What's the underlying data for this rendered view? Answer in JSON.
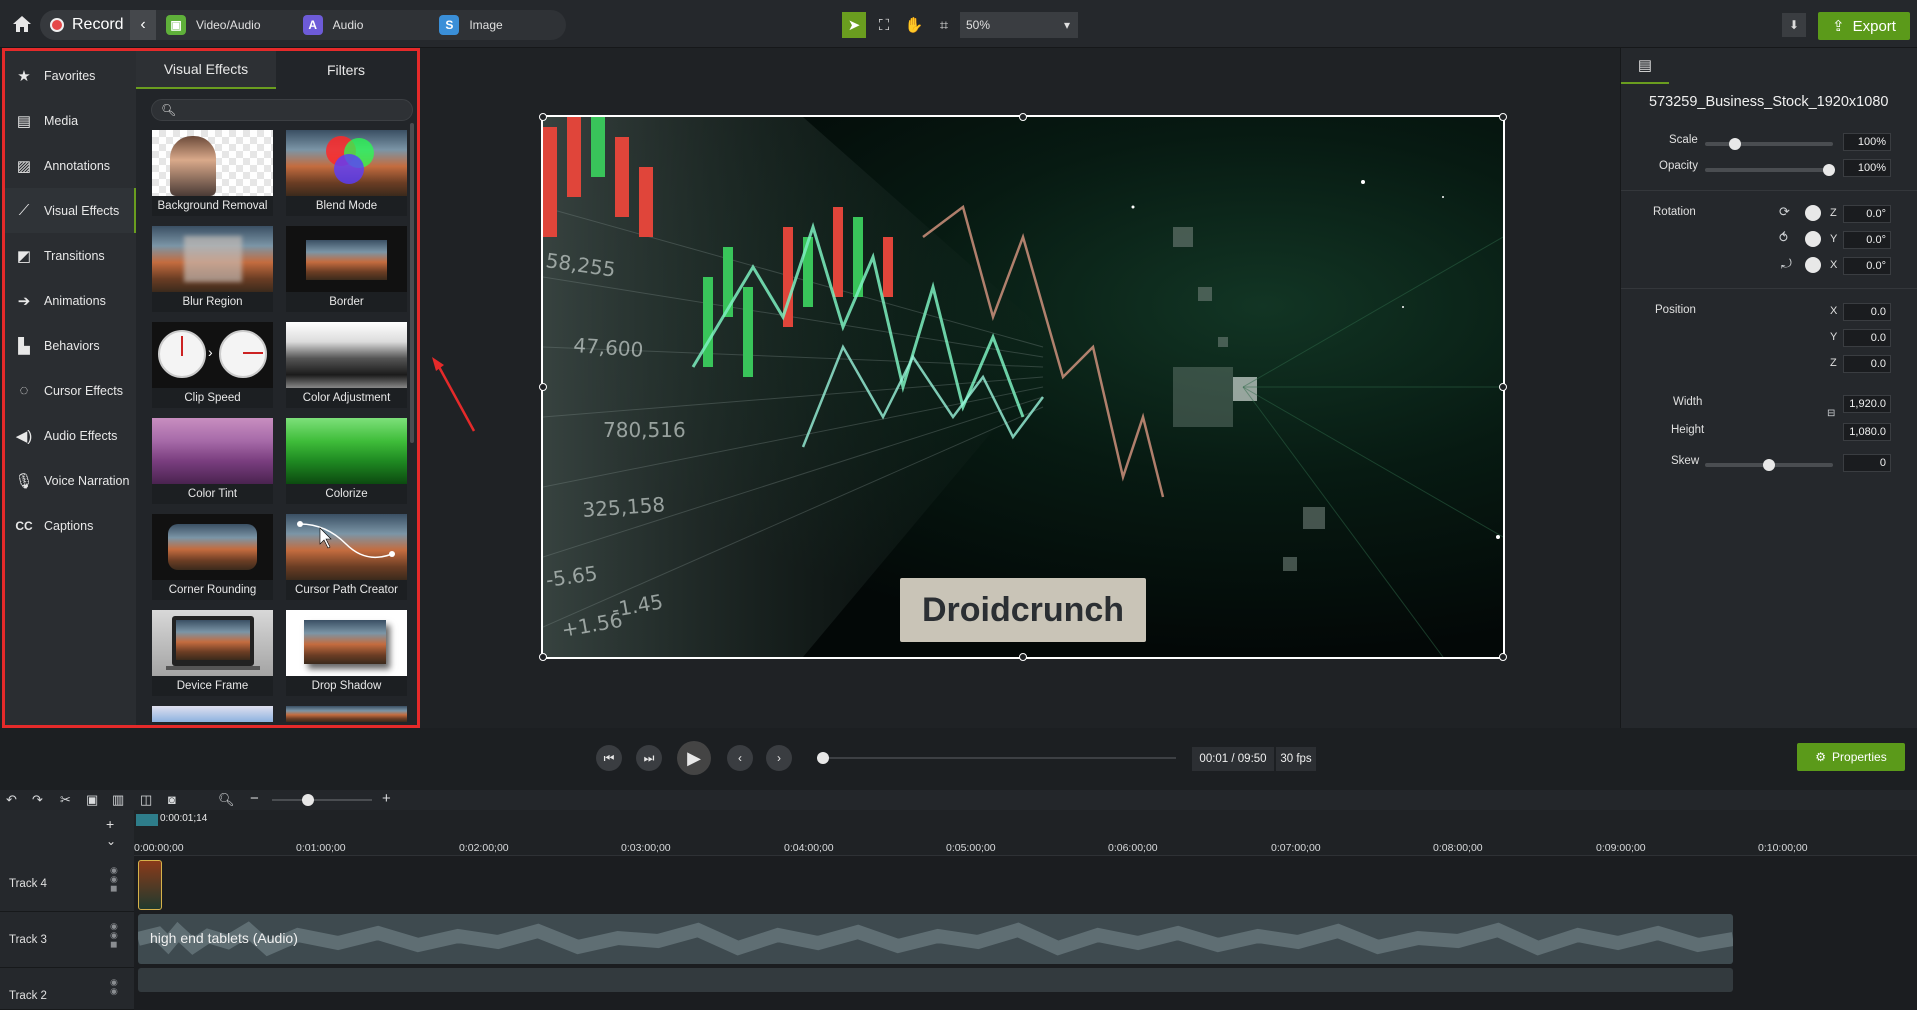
{
  "topbar": {
    "record_label": "Record",
    "media_tabs": [
      {
        "label": "Video/Audio",
        "icon": "video-audio-icon",
        "color": "#5fb03a"
      },
      {
        "label": "Audio",
        "icon": "audio-icon",
        "color": "#6d5bd8"
      },
      {
        "label": "Image",
        "icon": "image-icon",
        "color": "#3a8fd8"
      }
    ],
    "zoom_value": "50%",
    "export_label": "Export"
  },
  "sidebar": {
    "items": [
      {
        "label": "Favorites",
        "icon": "star-icon"
      },
      {
        "label": "Media",
        "icon": "film-icon"
      },
      {
        "label": "Annotations",
        "icon": "annotation-icon"
      },
      {
        "label": "Visual Effects",
        "icon": "wand-icon"
      },
      {
        "label": "Transitions",
        "icon": "transition-icon"
      },
      {
        "label": "Animations",
        "icon": "animation-icon"
      },
      {
        "label": "Behaviors",
        "icon": "behaviors-icon"
      },
      {
        "label": "Cursor Effects",
        "icon": "cursor-icon"
      },
      {
        "label": "Audio Effects",
        "icon": "speaker-icon"
      },
      {
        "label": "Voice Narration",
        "icon": "microphone-icon"
      },
      {
        "label": "Captions",
        "icon": "cc-icon"
      }
    ]
  },
  "effects_panel": {
    "tabs": [
      "Visual Effects",
      "Filters"
    ],
    "effects": [
      "Background Removal",
      "Blend Mode",
      "Blur Region",
      "Border",
      "Clip Speed",
      "Color Adjustment",
      "Color Tint",
      "Colorize",
      "Corner Rounding",
      "Cursor Path Creator",
      "Device Frame",
      "Drop Shadow"
    ]
  },
  "preview": {
    "watermark": "Droidcrunch"
  },
  "properties_panel": {
    "title": "573259_Business_Stock_1920x1080",
    "scale_label": "Scale",
    "scale_value": "100%",
    "opacity_label": "Opacity",
    "opacity_value": "100%",
    "rotation_label": "Rotation",
    "rotation": [
      {
        "axis": "Z",
        "value": "0.0°"
      },
      {
        "axis": "Y",
        "value": "0.0°"
      },
      {
        "axis": "X",
        "value": "0.0°"
      }
    ],
    "position_label": "Position",
    "position": [
      {
        "axis": "X",
        "value": "0.0"
      },
      {
        "axis": "Y",
        "value": "0.0"
      },
      {
        "axis": "Z",
        "value": "0.0"
      }
    ],
    "width_label": "Width",
    "width_value": "1,920.0",
    "height_label": "Height",
    "height_value": "1,080.0",
    "skew_label": "Skew",
    "skew_value": "0"
  },
  "playback": {
    "time": "00:01 / 09:50",
    "fps": "30 fps",
    "properties_label": "Properties"
  },
  "timeline": {
    "playhead_time": "0:00:01;14",
    "ticks": [
      "0:00:00;00",
      "0:01:00;00",
      "0:02:00;00",
      "0:03:00;00",
      "0:04:00;00",
      "0:05:00;00",
      "0:06:00;00",
      "0:07:00;00",
      "0:08:00;00",
      "0:09:00;00",
      "0:10:00;00"
    ],
    "tracks": [
      "Track 4",
      "Track 3",
      "Track 2"
    ],
    "audio_clip_label": "high end tablets (Audio)"
  },
  "colors": {
    "accent": "#6a9d1f",
    "highlight_box": "#e52a2a"
  }
}
